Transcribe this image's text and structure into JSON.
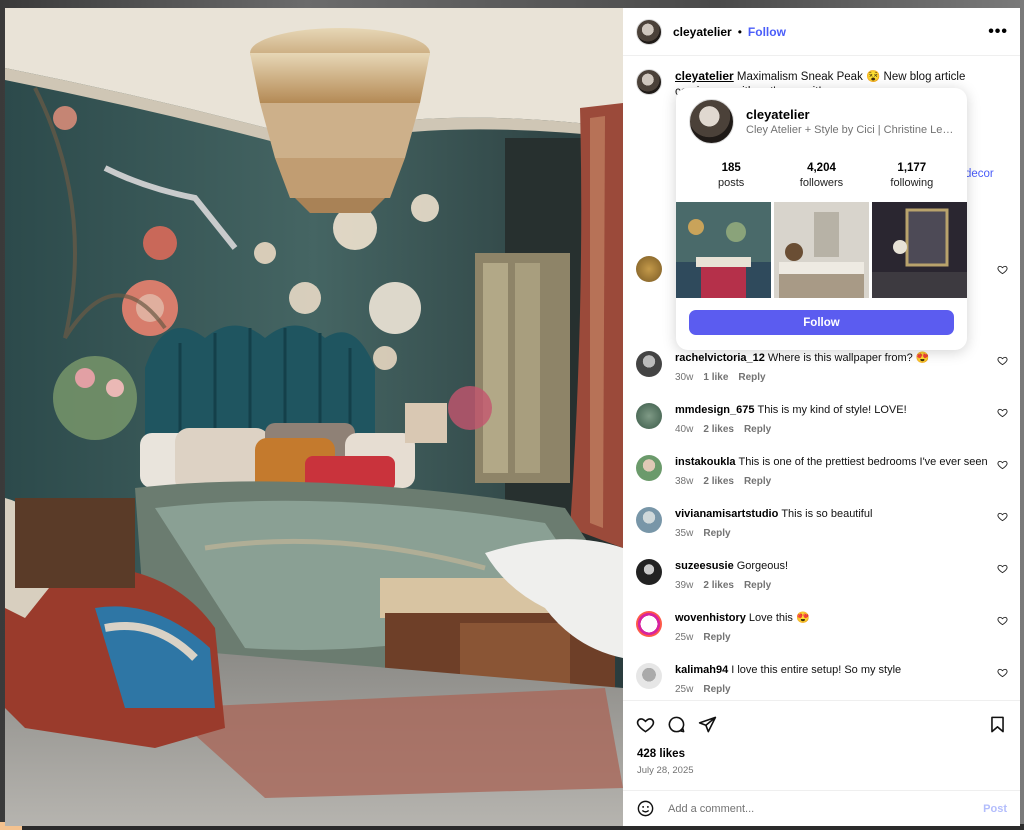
{
  "post": {
    "author": "cleyatelier",
    "follow_label": "Follow",
    "more_label": "•••",
    "caption_user": "cleyatelier",
    "caption_text": "Maximalism Sneak Peak 😵 New blog article coming s... with ... t's ... ve it!",
    "hashtag_fragment": "decor",
    "likes": "428 likes",
    "date": "July 28, 2025"
  },
  "comments": [
    {
      "user": "rachelvictoria_12",
      "text": "Where is this wallpaper from? 😍",
      "age": "30w",
      "likes": "1 like",
      "reply": "Reply"
    },
    {
      "user": "mmdesign_675",
      "text": "This is my kind of style! LOVE!",
      "age": "40w",
      "likes": "2 likes",
      "reply": "Reply"
    },
    {
      "user": "instakoukla",
      "text": "This is one of the prettiest bedrooms I've ever seen",
      "age": "38w",
      "likes": "2 likes",
      "reply": "Reply"
    },
    {
      "user": "vivianamisartstudio",
      "text": "This is so beautiful",
      "age": "35w",
      "likes": "",
      "reply": "Reply"
    },
    {
      "user": "suzeesusie",
      "text": "Gorgeous!",
      "age": "39w",
      "likes": "2 likes",
      "reply": "Reply"
    },
    {
      "user": "wovenhistory",
      "text": "Love this 😍",
      "age": "25w",
      "likes": "",
      "reply": "Reply"
    },
    {
      "user": "kalimah94",
      "text": "I love this entire setup! So my style",
      "age": "25w",
      "likes": "",
      "reply": "Reply"
    }
  ],
  "hovercard": {
    "username": "cleyatelier",
    "full_name": "Cley Atelier + Style by Cici | Christine Ley...",
    "stats": [
      {
        "num": "185",
        "label": "posts"
      },
      {
        "num": "4,204",
        "label": "followers"
      },
      {
        "num": "1,177",
        "label": "following"
      }
    ],
    "follow_label": "Follow"
  },
  "composer": {
    "placeholder": "Add a comment...",
    "post_label": "Post"
  },
  "colors": {
    "accent": "#4a5df9",
    "follow_button": "#5b5cf0",
    "muted": "#737373"
  },
  "icons": [
    "heart-icon",
    "comment-icon",
    "share-icon",
    "bookmark-icon",
    "emoji-icon",
    "more-icon"
  ]
}
